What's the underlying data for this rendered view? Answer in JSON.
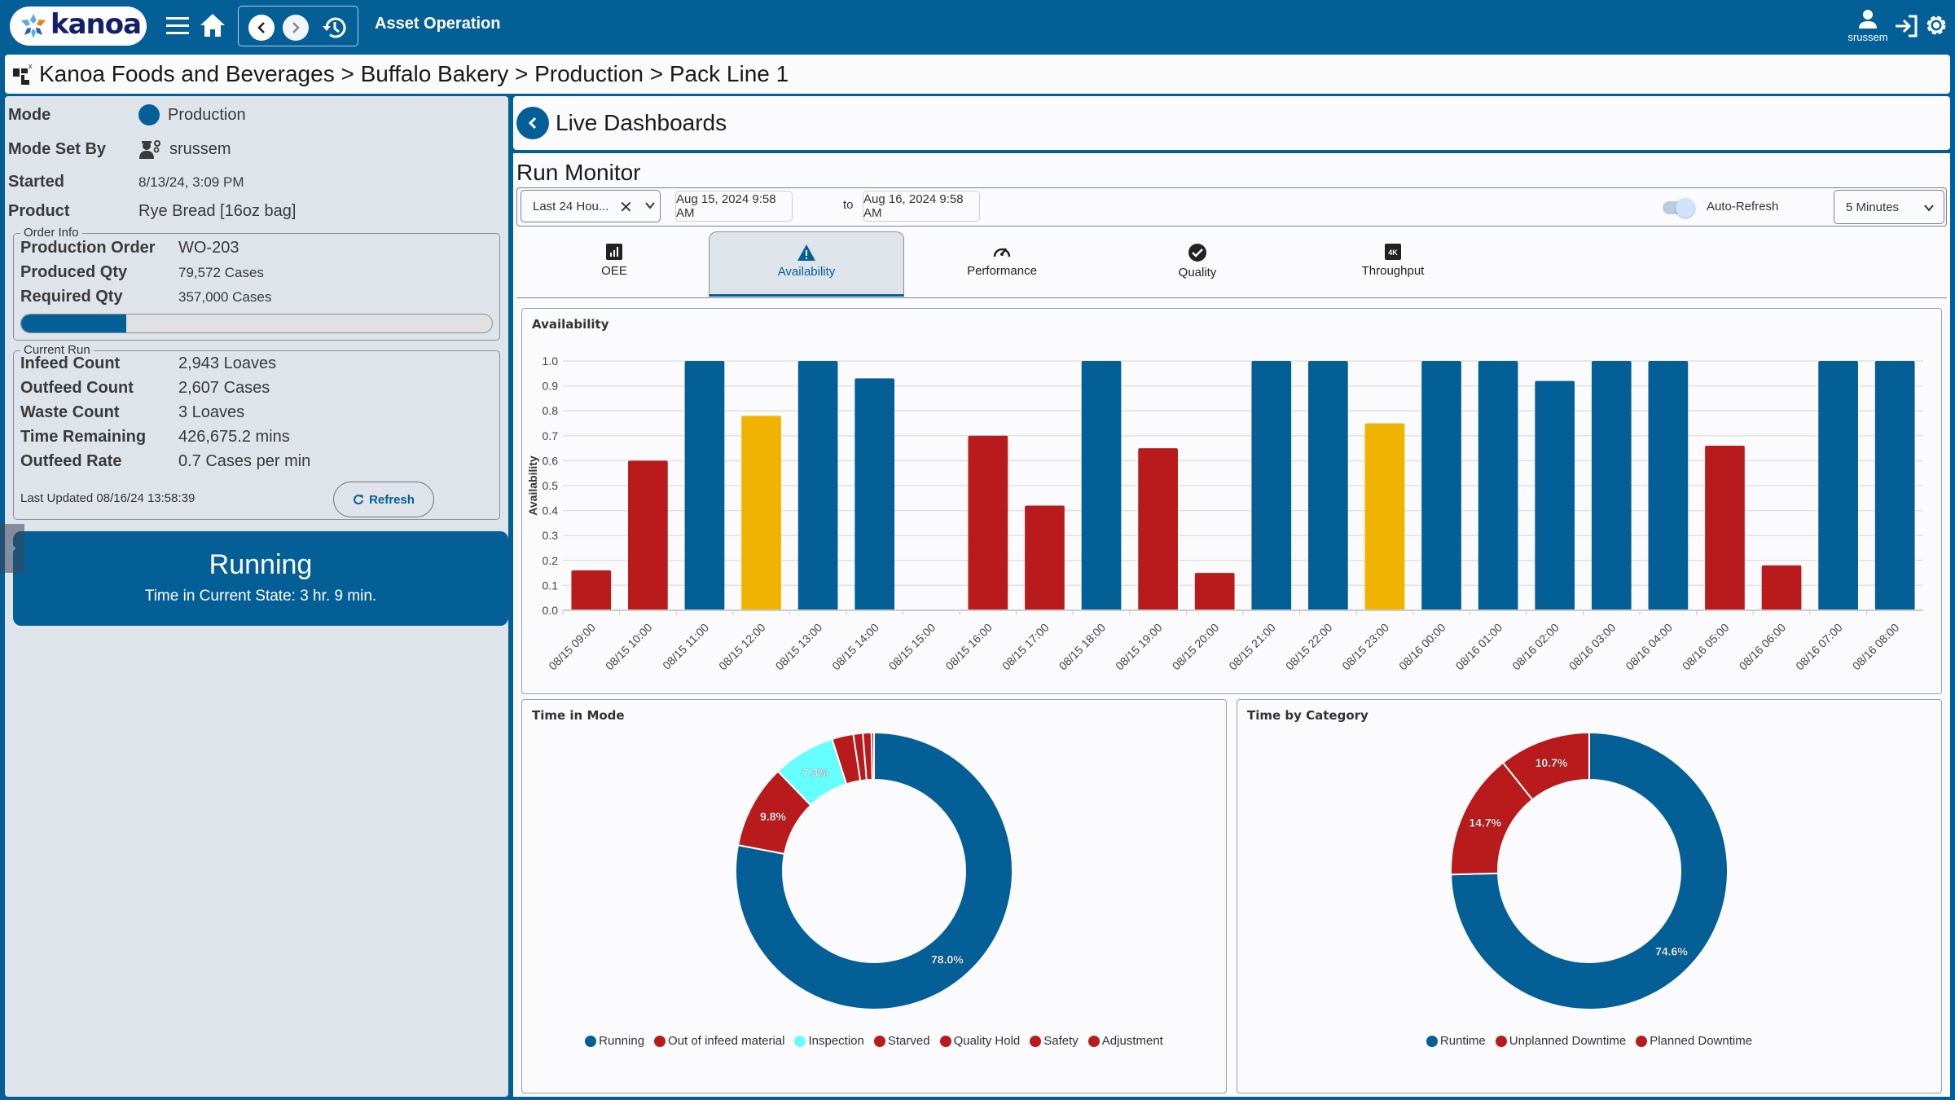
{
  "topbar": {
    "logo_text": "kanoa",
    "app_title": "Asset Operation",
    "username": "srussem"
  },
  "breadcrumb": {
    "path": "Kanoa Foods and Beverages > Buffalo Bakery > Production > Pack Line 1"
  },
  "left_panel": {
    "mode_label": "Mode",
    "mode_value": "Production",
    "mode_color": "#045f97",
    "mode_set_by_label": "Mode Set By",
    "mode_set_by_value": "srussem",
    "started_label": "Started",
    "started_value": "8/13/24, 3:09 PM",
    "product_label": "Product",
    "product_value": "Rye Bread [16oz bag]",
    "order_info": {
      "legend": "Order Info",
      "production_order_label": "Production Order",
      "production_order_value": "WO-203",
      "produced_qty_label": "Produced Qty",
      "produced_qty_value": "79,572 Cases",
      "required_qty_label": "Required Qty",
      "required_qty_value": "357,000 Cases",
      "progress_fraction": 0.223
    },
    "current_run": {
      "legend": "Current Run",
      "rows": [
        {
          "label": "Infeed Count",
          "value": "2,943 Loaves"
        },
        {
          "label": "Outfeed Count",
          "value": "2,607 Cases"
        },
        {
          "label": "Waste Count",
          "value": "3 Loaves"
        },
        {
          "label": "Time Remaining",
          "value": "426,675.2 mins"
        },
        {
          "label": "Outfeed Rate",
          "value": "0.7 Cases per min"
        }
      ],
      "last_updated": "Last Updated 08/16/24 13:58:39",
      "refresh_label": "Refresh"
    },
    "state": {
      "title": "Running",
      "subtitle": "Time in Current State: 3 hr. 9 min."
    }
  },
  "dashboard": {
    "header_title": "Live Dashboards",
    "title": "Run Monitor",
    "range_select": "Last 24 Hou...",
    "start_date": "Aug 15, 2024 9:58 AM",
    "to_label": "to",
    "end_date": "Aug 16, 2024 9:58 AM",
    "auto_refresh_label": "Auto-Refresh",
    "auto_refresh_on": true,
    "interval": "5 Minutes",
    "tabs": [
      {
        "label": "OEE",
        "icon": "bar-chart-icon"
      },
      {
        "label": "Availability",
        "icon": "warning-icon",
        "active": true
      },
      {
        "label": "Performance",
        "icon": "speedometer-icon"
      },
      {
        "label": "Quality",
        "icon": "check-circle-icon"
      },
      {
        "label": "Throughput",
        "icon": "4k-icon"
      }
    ]
  },
  "colors": {
    "primary": "#045f97",
    "red": "#b91b1c",
    "yellow": "#f0b400",
    "cyan": "#66ffff"
  },
  "chart_data": [
    {
      "type": "bar",
      "title": "Availability",
      "xlabel": "",
      "ylabel": "Availability",
      "ylim": [
        0,
        1.0
      ],
      "yticks": [
        "0.0",
        "0.1",
        "0.2",
        "0.3",
        "0.4",
        "0.5",
        "0.6",
        "0.7",
        "0.8",
        "0.9",
        "1.0"
      ],
      "grid": true,
      "categories": [
        "08/15 09:00",
        "08/15 10:00",
        "08/15 11:00",
        "08/15 12:00",
        "08/15 13:00",
        "08/15 14:00",
        "08/15 15:00",
        "08/15 16:00",
        "08/15 17:00",
        "08/15 18:00",
        "08/15 19:00",
        "08/15 20:00",
        "08/15 21:00",
        "08/15 22:00",
        "08/15 23:00",
        "08/16 00:00",
        "08/16 01:00",
        "08/16 02:00",
        "08/16 03:00",
        "08/16 04:00",
        "08/16 05:00",
        "08/16 06:00",
        "08/16 07:00",
        "08/16 08:00"
      ],
      "values": [
        0.16,
        0.6,
        1.0,
        0.78,
        1.0,
        0.93,
        0,
        0.7,
        0.42,
        1.0,
        0.65,
        0.15,
        1.0,
        1.0,
        0.75,
        1.0,
        1.0,
        0.92,
        1.0,
        1.0,
        0.66,
        0.18,
        1.0,
        1.0
      ],
      "bar_colors": [
        "#b91b1c",
        "#b91b1c",
        "#045f97",
        "#f0b400",
        "#045f97",
        "#045f97",
        "#045f97",
        "#b91b1c",
        "#b91b1c",
        "#045f97",
        "#b91b1c",
        "#b91b1c",
        "#045f97",
        "#045f97",
        "#f0b400",
        "#045f97",
        "#045f97",
        "#045f97",
        "#045f97",
        "#045f97",
        "#b91b1c",
        "#b91b1c",
        "#045f97",
        "#045f97"
      ]
    },
    {
      "type": "pie",
      "title": "Time in Mode",
      "donut": true,
      "legend_position": "bottom",
      "slices": [
        {
          "label": "Running",
          "value": 78.0,
          "color": "#045f97",
          "show_label": true
        },
        {
          "label": "Out of infeed material",
          "value": 9.8,
          "color": "#b91b1c",
          "show_label": true
        },
        {
          "label": "Inspection",
          "value": 7.3,
          "color": "#66ffff",
          "show_label": true
        },
        {
          "label": "Starved",
          "value": 2.5,
          "color": "#b91b1c",
          "show_label": false
        },
        {
          "label": "Quality Hold",
          "value": 1.1,
          "color": "#b91b1c",
          "show_label": false
        },
        {
          "label": "Safety",
          "value": 1.0,
          "color": "#b91b1c",
          "show_label": false
        },
        {
          "label": "Adjustment",
          "value": 0.3,
          "color": "#b91b1c",
          "show_label": false
        }
      ]
    },
    {
      "type": "pie",
      "title": "Time by Category",
      "donut": true,
      "legend_position": "bottom",
      "slices": [
        {
          "label": "Runtime",
          "value": 74.6,
          "color": "#045f97",
          "show_label": true
        },
        {
          "label": "Unplanned Downtime",
          "value": 14.7,
          "color": "#b91b1c",
          "show_label": true
        },
        {
          "label": "Planned Downtime",
          "value": 10.7,
          "color": "#b91b1c",
          "show_label": true
        }
      ]
    }
  ]
}
